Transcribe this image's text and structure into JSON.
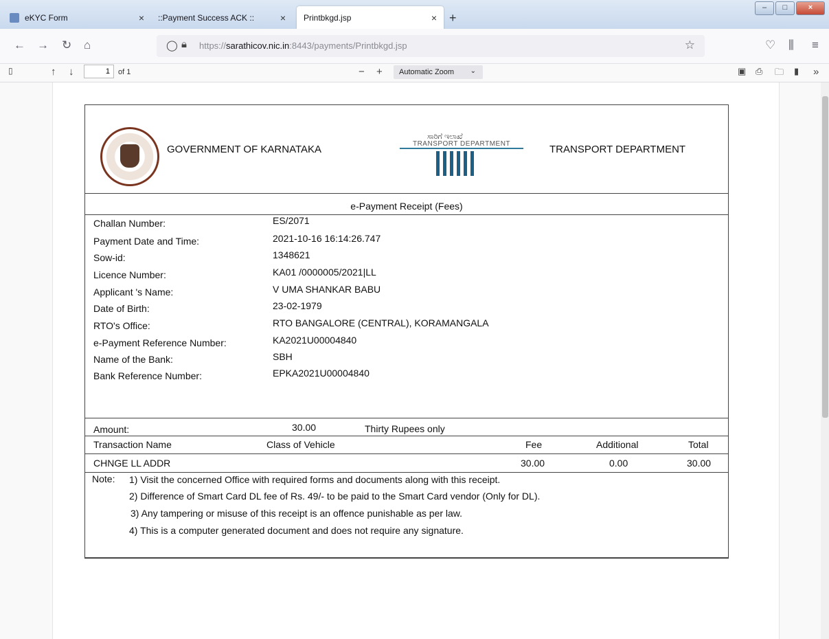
{
  "browser": {
    "tabs": [
      {
        "label": "eKYC Form"
      },
      {
        "label": "::Payment Success ACK ::"
      },
      {
        "label": "Printbkgd.jsp"
      }
    ],
    "url_prefix": "https://",
    "url_host": "sarathicov.nic.in",
    "url_rest": ":8443/payments/Printbkgd.jsp"
  },
  "pdf_toolbar": {
    "page_number": "1",
    "page_of": "of 1",
    "zoom": "Automatic Zoom"
  },
  "receipt": {
    "gov_title": "GOVERNMENT OF KARNATAKA",
    "dept_title": "TRANSPORT DEPARTMENT",
    "logo_text_kannada": "ಸಾರಿಗೆ ಇಲಾಖೆ",
    "logo_text_english": "TRANSPORT DEPARTMENT",
    "receipt_title": "e-Payment Receipt (Fees)",
    "fields": [
      {
        "label": "Challan Number:",
        "value": "ES/2071"
      },
      {
        "label": "Payment Date and Time:",
        "value": "2021-10-16 16:14:26.747"
      },
      {
        "label": "Sow-id:",
        "value": "1348621"
      },
      {
        "label": "Licence Number:",
        "value": "KA01 /0000005/2021|LL"
      },
      {
        "label": "Applicant 's Name:",
        "value": "V UMA SHANKAR BABU"
      },
      {
        "label": "Date of Birth:",
        "value": "23-02-1979"
      },
      {
        "label": "RTO's Office:",
        "value": "RTO BANGALORE (CENTRAL), KORAMANGALA"
      },
      {
        "label": "e-Payment Reference Number:",
        "value": "KA2021U00004840"
      },
      {
        "label": "Name of the Bank:",
        "value": "SBH"
      },
      {
        "label": "Bank Reference Number:",
        "value": "EPKA2021U00004840"
      }
    ],
    "amount_label": "Amount:",
    "amount_value": "30.00",
    "amount_words": "Thirty Rupees only",
    "transaction_headers": {
      "name": "Transaction Name",
      "class": "Class of Vehicle",
      "fee": "Fee",
      "additional": "Additional",
      "total": "Total"
    },
    "transaction_row": {
      "name": "CHNGE LL ADDR",
      "class": "",
      "fee": "30.00",
      "additional": "0.00",
      "total": "30.00"
    },
    "note_label": "Note:",
    "notes": [
      "1) Visit the concerned Office with required forms and documents along with this receipt.",
      "2) Difference of Smart Card DL fee of Rs. 49/- to be paid to the Smart Card vendor (Only for DL).",
      "3) Any tampering or misuse of this receipt is an offence punishable as per law.",
      "4) This is a computer generated document and does not require any signature."
    ]
  }
}
